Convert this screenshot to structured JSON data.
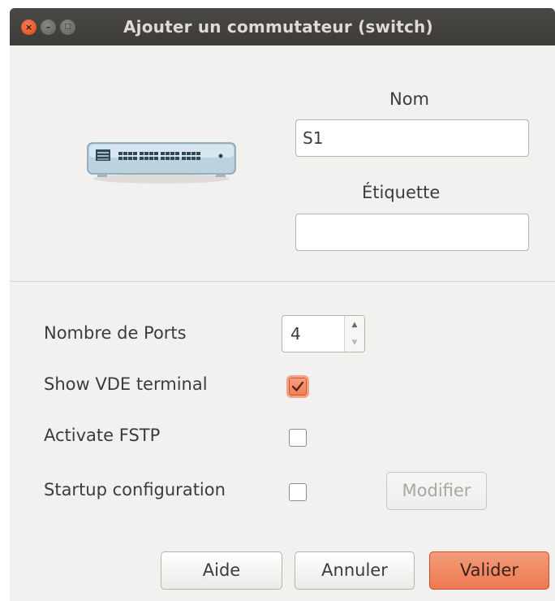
{
  "window": {
    "title": "Ajouter un commutateur (switch)",
    "controls": {
      "close": "×",
      "minimize": "–",
      "maximize": "□"
    }
  },
  "device": {
    "icon": "network-switch-icon"
  },
  "name_field": {
    "label": "Nom",
    "value": "S1"
  },
  "tag_field": {
    "label": "Étiquette",
    "value": ""
  },
  "ports": {
    "label": "Nombre de Ports",
    "value": "4"
  },
  "options": {
    "vde_terminal": {
      "label": "Show VDE terminal",
      "checked": true
    },
    "fstp": {
      "label": "Activate FSTP",
      "checked": false
    },
    "startup_config": {
      "label": "Startup configuration",
      "checked": false,
      "modify_label": "Modifier"
    }
  },
  "buttons": {
    "help": "Aide",
    "cancel": "Annuler",
    "ok": "Valider"
  },
  "colors": {
    "accent": "#ec7a52",
    "titlebar": "#3c3b37",
    "background": "#f2f1f0"
  }
}
